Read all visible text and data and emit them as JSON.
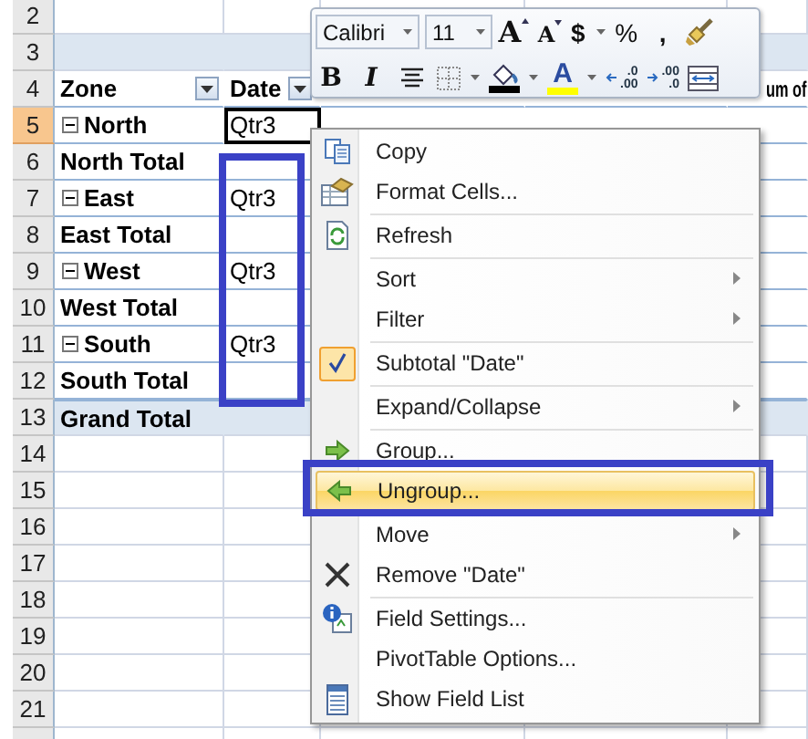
{
  "sheet": {
    "rows": [
      {
        "number": "2",
        "kind": "empty"
      },
      {
        "number": "3",
        "kind": "band"
      },
      {
        "number": "4",
        "kind": "header",
        "zone": "Zone",
        "date": "Date",
        "column_5": "um of"
      },
      {
        "number": "5",
        "kind": "item",
        "zone": "North",
        "date": "Qtr3",
        "expanded": true,
        "selected": true
      },
      {
        "number": "6",
        "kind": "total",
        "zone": "North Total"
      },
      {
        "number": "7",
        "kind": "item",
        "zone": "East",
        "date": "Qtr3",
        "expanded": true,
        "selected": false
      },
      {
        "number": "8",
        "kind": "total",
        "zone": "East Total"
      },
      {
        "number": "9",
        "kind": "item",
        "zone": "West",
        "date": "Qtr3",
        "expanded": true,
        "selected": false
      },
      {
        "number": "10",
        "kind": "total",
        "zone": "West Total"
      },
      {
        "number": "11",
        "kind": "item",
        "zone": "South",
        "date": "Qtr3",
        "expanded": true,
        "selected": false
      },
      {
        "number": "12",
        "kind": "total",
        "zone": "South Total"
      },
      {
        "number": "13",
        "kind": "grand",
        "zone": "Grand Total"
      },
      {
        "number": "14",
        "kind": "empty"
      },
      {
        "number": "15",
        "kind": "empty"
      },
      {
        "number": "16",
        "kind": "empty"
      },
      {
        "number": "17",
        "kind": "empty"
      },
      {
        "number": "18",
        "kind": "empty"
      },
      {
        "number": "19",
        "kind": "empty"
      },
      {
        "number": "20",
        "kind": "empty"
      },
      {
        "number": "21",
        "kind": "empty"
      }
    ]
  },
  "mini_toolbar": {
    "font": "Calibri",
    "size": "11",
    "row_1": [
      {
        "kind": "grow",
        "label": "A"
      },
      {
        "kind": "shrink",
        "label": "A"
      },
      {
        "kind": "currency",
        "label": "$"
      },
      {
        "kind": "percent",
        "label": "%"
      },
      {
        "kind": "comma",
        "label": ","
      },
      {
        "kind": "painter"
      }
    ],
    "row_2": [
      {
        "kind": "bold",
        "label": "B"
      },
      {
        "kind": "italic",
        "label": "I"
      },
      {
        "kind": "center"
      },
      {
        "kind": "borders"
      },
      {
        "kind": "fill"
      },
      {
        "kind": "fontcolor",
        "label": "A"
      },
      {
        "kind": "incdec",
        "top": ".0",
        "bottom": ".00"
      },
      {
        "kind": "decdec",
        "top": ".00",
        "bottom": ".0"
      },
      {
        "kind": "merge"
      }
    ]
  },
  "context_menu": {
    "items": [
      {
        "kind": "copy",
        "label": "Copy",
        "submenu": false,
        "selected": false
      },
      {
        "kind": "format",
        "label": "Format Cells...",
        "submenu": false,
        "selected": false
      },
      {
        "kind": "separator"
      },
      {
        "kind": "refresh",
        "label": "Refresh",
        "submenu": false,
        "selected": false
      },
      {
        "kind": "separator"
      },
      {
        "kind": "plain",
        "label": "Sort",
        "submenu": true,
        "selected": false
      },
      {
        "kind": "plain",
        "label": "Filter",
        "submenu": true,
        "selected": false
      },
      {
        "kind": "separator"
      },
      {
        "kind": "check",
        "label": "Subtotal \"Date\"",
        "submenu": false,
        "selected": false,
        "checked": true
      },
      {
        "kind": "separator"
      },
      {
        "kind": "plain",
        "label": "Expand/Collapse",
        "submenu": true,
        "selected": false
      },
      {
        "kind": "separator"
      },
      {
        "kind": "group",
        "label": "Group...",
        "submenu": false,
        "selected": false
      },
      {
        "kind": "ungroup",
        "label": "Ungroup...",
        "submenu": false,
        "selected": true
      },
      {
        "kind": "separator"
      },
      {
        "kind": "plain",
        "label": "Move",
        "submenu": true,
        "selected": false
      },
      {
        "kind": "remove",
        "label": "Remove \"Date\"",
        "submenu": false,
        "selected": false
      },
      {
        "kind": "separator"
      },
      {
        "kind": "settings",
        "label": "Field Settings...",
        "submenu": false,
        "selected": false
      },
      {
        "kind": "plain",
        "label": "PivotTable Options...",
        "submenu": false,
        "selected": false
      },
      {
        "kind": "fieldlist",
        "label": "Show Field List",
        "submenu": false,
        "selected": false
      }
    ]
  }
}
